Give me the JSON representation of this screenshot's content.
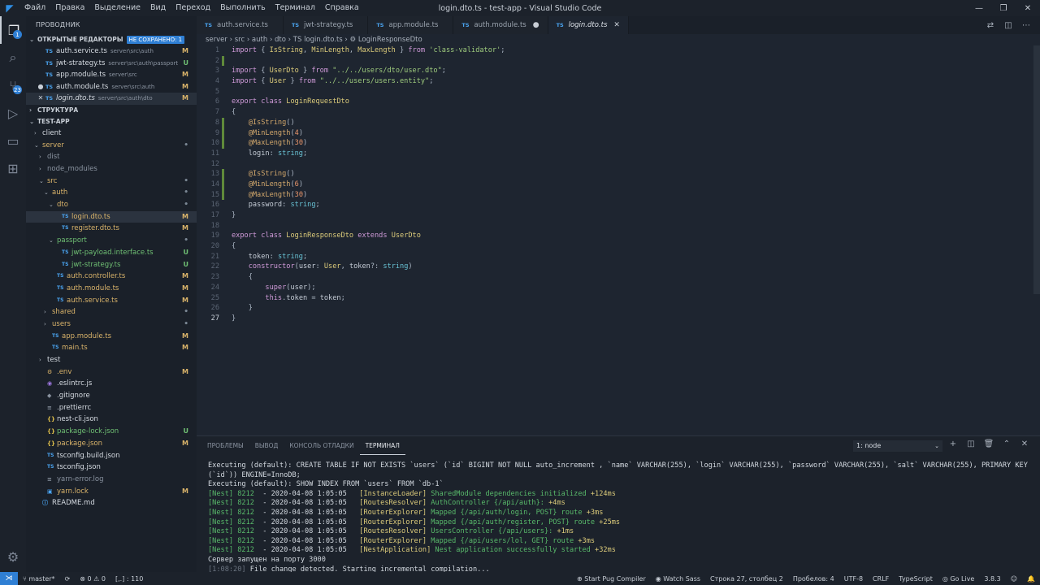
{
  "window": {
    "title": "login.dto.ts - test-app - Visual Studio Code",
    "menu": [
      "Файл",
      "Правка",
      "Выделение",
      "Вид",
      "Переход",
      "Выполнить",
      "Терминал",
      "Справка"
    ]
  },
  "activity": {
    "scm_badge": "23",
    "explorer_badge": "1"
  },
  "sidebar": {
    "title": "ПРОВОДНИК",
    "open_editors_label": "ОТКРЫТЫЕ РЕДАКТОРЫ",
    "unsaved_label": "НЕ СОХРАНЕНО: 1",
    "open_editors": [
      {
        "icon": "TS",
        "name": "auth.service.ts",
        "path": "server\\src\\auth",
        "status": "M",
        "mark": ""
      },
      {
        "icon": "TS",
        "name": "jwt-strategy.ts",
        "path": "server\\src\\auth\\passport",
        "status": "U",
        "mark": ""
      },
      {
        "icon": "TS",
        "name": "app.module.ts",
        "path": "server\\src",
        "status": "M",
        "mark": ""
      },
      {
        "icon": "TS",
        "name": "auth.module.ts",
        "path": "server\\src\\auth",
        "status": "M",
        "mark": "●"
      },
      {
        "icon": "TS",
        "name": "login.dto.ts",
        "path": "server\\src\\auth\\dto",
        "status": "M",
        "mark": "✕"
      }
    ],
    "outline_label": "СТРУКТУРА",
    "project_label": "TEST-APP",
    "tree": [
      {
        "depth": 0,
        "twist": "›",
        "icon": "",
        "name": "client",
        "status": "",
        "cls": ""
      },
      {
        "depth": 0,
        "twist": "⌄",
        "icon": "",
        "name": "server",
        "status": "•",
        "cls": "c-M"
      },
      {
        "depth": 1,
        "twist": "›",
        "icon": "",
        "name": "dist",
        "status": "",
        "cls": "c-dim"
      },
      {
        "depth": 1,
        "twist": "›",
        "icon": "",
        "name": "node_modules",
        "status": "",
        "cls": "c-dim"
      },
      {
        "depth": 1,
        "twist": "⌄",
        "icon": "",
        "name": "src",
        "status": "•",
        "cls": "c-M"
      },
      {
        "depth": 2,
        "twist": "⌄",
        "icon": "",
        "name": "auth",
        "status": "•",
        "cls": "c-M"
      },
      {
        "depth": 3,
        "twist": "⌄",
        "icon": "",
        "name": "dto",
        "status": "•",
        "cls": "c-M"
      },
      {
        "depth": 4,
        "twist": "",
        "icon": "TS",
        "name": "login.dto.ts",
        "status": "M",
        "cls": "c-M",
        "sel": true
      },
      {
        "depth": 4,
        "twist": "",
        "icon": "TS",
        "name": "register.dto.ts",
        "status": "M",
        "cls": "c-M"
      },
      {
        "depth": 3,
        "twist": "⌄",
        "icon": "",
        "name": "passport",
        "status": "•",
        "cls": "c-U"
      },
      {
        "depth": 4,
        "twist": "",
        "icon": "TS",
        "name": "jwt-payload.interface.ts",
        "status": "U",
        "cls": "c-U"
      },
      {
        "depth": 4,
        "twist": "",
        "icon": "TS",
        "name": "jwt-strategy.ts",
        "status": "U",
        "cls": "c-U"
      },
      {
        "depth": 3,
        "twist": "",
        "icon": "TS",
        "name": "auth.controller.ts",
        "status": "M",
        "cls": "c-M"
      },
      {
        "depth": 3,
        "twist": "",
        "icon": "TS",
        "name": "auth.module.ts",
        "status": "M",
        "cls": "c-M"
      },
      {
        "depth": 3,
        "twist": "",
        "icon": "TS",
        "name": "auth.service.ts",
        "status": "M",
        "cls": "c-M"
      },
      {
        "depth": 2,
        "twist": "›",
        "icon": "",
        "name": "shared",
        "status": "•",
        "cls": "c-M"
      },
      {
        "depth": 2,
        "twist": "›",
        "icon": "",
        "name": "users",
        "status": "•",
        "cls": "c-M"
      },
      {
        "depth": 2,
        "twist": "",
        "icon": "TS",
        "name": "app.module.ts",
        "status": "M",
        "cls": "c-M"
      },
      {
        "depth": 2,
        "twist": "",
        "icon": "TS",
        "name": "main.ts",
        "status": "M",
        "cls": "c-M"
      },
      {
        "depth": 1,
        "twist": "›",
        "icon": "",
        "name": "test",
        "status": "",
        "cls": ""
      },
      {
        "depth": 1,
        "twist": "",
        "icon": "⚙",
        "name": ".env",
        "status": "M",
        "cls": "c-M"
      },
      {
        "depth": 1,
        "twist": "",
        "icon": "◉",
        "name": ".eslintrc.js",
        "status": "",
        "cls": ""
      },
      {
        "depth": 1,
        "twist": "",
        "icon": "◆",
        "name": ".gitignore",
        "status": "",
        "cls": ""
      },
      {
        "depth": 1,
        "twist": "",
        "icon": "≡",
        "name": ".prettierrc",
        "status": "",
        "cls": ""
      },
      {
        "depth": 1,
        "twist": "",
        "icon": "{}",
        "name": "nest-cli.json",
        "status": "",
        "cls": ""
      },
      {
        "depth": 1,
        "twist": "",
        "icon": "{}",
        "name": "package-lock.json",
        "status": "U",
        "cls": "c-U"
      },
      {
        "depth": 1,
        "twist": "",
        "icon": "{}",
        "name": "package.json",
        "status": "M",
        "cls": "c-M"
      },
      {
        "depth": 1,
        "twist": "",
        "icon": "TS",
        "name": "tsconfig.build.json",
        "status": "",
        "cls": ""
      },
      {
        "depth": 1,
        "twist": "",
        "icon": "TS",
        "name": "tsconfig.json",
        "status": "",
        "cls": ""
      },
      {
        "depth": 1,
        "twist": "",
        "icon": "≡",
        "name": "yarn-error.log",
        "status": "",
        "cls": "c-dim"
      },
      {
        "depth": 1,
        "twist": "",
        "icon": "▣",
        "name": "yarn.lock",
        "status": "M",
        "cls": "c-M"
      },
      {
        "depth": 0,
        "twist": "",
        "icon": "ⓘ",
        "name": "README.md",
        "status": "",
        "cls": ""
      }
    ]
  },
  "tabs": [
    {
      "name": "auth.service.ts",
      "active": false,
      "mark": ""
    },
    {
      "name": "jwt-strategy.ts",
      "active": false,
      "mark": ""
    },
    {
      "name": "app.module.ts",
      "active": false,
      "mark": ""
    },
    {
      "name": "auth.module.ts",
      "active": false,
      "mark": "●"
    },
    {
      "name": "login.dto.ts",
      "active": true,
      "mark": "✕"
    }
  ],
  "breadcrumb": "server › src › auth › dto › TS login.dto.ts › ⚙ LoginResponseDto",
  "code": [
    [
      [
        "k",
        "import"
      ],
      [
        "p",
        " { "
      ],
      [
        "t",
        "IsString"
      ],
      [
        "p",
        ", "
      ],
      [
        "t",
        "MinLength"
      ],
      [
        "p",
        ", "
      ],
      [
        "t",
        "MaxLength"
      ],
      [
        "p",
        " } "
      ],
      [
        "k",
        "from"
      ],
      [
        "p",
        " "
      ],
      [
        "s",
        "'class-validator'"
      ],
      [
        "p",
        ";"
      ]
    ],
    [],
    [
      [
        "k",
        "import"
      ],
      [
        "p",
        " { "
      ],
      [
        "t",
        "UserDto"
      ],
      [
        "p",
        " } "
      ],
      [
        "k",
        "from"
      ],
      [
        "p",
        " "
      ],
      [
        "s",
        "\"../../users/dto/user.dto\""
      ],
      [
        "p",
        ";"
      ]
    ],
    [
      [
        "k",
        "import"
      ],
      [
        "p",
        " { "
      ],
      [
        "t",
        "User"
      ],
      [
        "p",
        " } "
      ],
      [
        "k",
        "from"
      ],
      [
        "p",
        " "
      ],
      [
        "s",
        "\"../../users/users.entity\""
      ],
      [
        "p",
        ";"
      ]
    ],
    [],
    [
      [
        "k",
        "export"
      ],
      [
        "p",
        " "
      ],
      [
        "k",
        "class"
      ],
      [
        "p",
        " "
      ],
      [
        "t",
        "LoginRequestDto"
      ]
    ],
    [
      [
        "p",
        "{"
      ]
    ],
    [
      [
        "p",
        "    "
      ],
      [
        "d",
        "@IsString"
      ],
      [
        "p",
        "()"
      ]
    ],
    [
      [
        "p",
        "    "
      ],
      [
        "d",
        "@MinLength"
      ],
      [
        "p",
        "("
      ],
      [
        "n",
        "4"
      ],
      [
        "p",
        ")"
      ]
    ],
    [
      [
        "p",
        "    "
      ],
      [
        "d",
        "@MaxLength"
      ],
      [
        "p",
        "("
      ],
      [
        "n",
        "30"
      ],
      [
        "p",
        ")"
      ]
    ],
    [
      [
        "p",
        "    "
      ],
      [
        "i",
        "login"
      ],
      [
        "p",
        ": "
      ],
      [
        "c",
        "string"
      ],
      [
        "p",
        ";"
      ]
    ],
    [],
    [
      [
        "p",
        "    "
      ],
      [
        "d",
        "@IsString"
      ],
      [
        "p",
        "()"
      ]
    ],
    [
      [
        "p",
        "    "
      ],
      [
        "d",
        "@MinLength"
      ],
      [
        "p",
        "("
      ],
      [
        "n",
        "6"
      ],
      [
        "p",
        ")"
      ]
    ],
    [
      [
        "p",
        "    "
      ],
      [
        "d",
        "@MaxLength"
      ],
      [
        "p",
        "("
      ],
      [
        "n",
        "30"
      ],
      [
        "p",
        ")"
      ]
    ],
    [
      [
        "p",
        "    "
      ],
      [
        "i",
        "password"
      ],
      [
        "p",
        ": "
      ],
      [
        "c",
        "string"
      ],
      [
        "p",
        ";"
      ]
    ],
    [
      [
        "p",
        "}"
      ]
    ],
    [],
    [
      [
        "k",
        "export"
      ],
      [
        "p",
        " "
      ],
      [
        "k",
        "class"
      ],
      [
        "p",
        " "
      ],
      [
        "t",
        "LoginResponseDto"
      ],
      [
        "p",
        " "
      ],
      [
        "k",
        "extends"
      ],
      [
        "p",
        " "
      ],
      [
        "t",
        "UserDto"
      ]
    ],
    [
      [
        "p",
        "{"
      ]
    ],
    [
      [
        "p",
        "    "
      ],
      [
        "i",
        "token"
      ],
      [
        "p",
        ": "
      ],
      [
        "c",
        "string"
      ],
      [
        "p",
        ";"
      ]
    ],
    [
      [
        "p",
        "    "
      ],
      [
        "k",
        "constructor"
      ],
      [
        "p",
        "("
      ],
      [
        "i",
        "user"
      ],
      [
        "p",
        ": "
      ],
      [
        "t",
        "User"
      ],
      [
        "p",
        ", "
      ],
      [
        "i",
        "token"
      ],
      [
        "p",
        "?: "
      ],
      [
        "c",
        "string"
      ],
      [
        "p",
        ")"
      ]
    ],
    [
      [
        "p",
        "    {"
      ]
    ],
    [
      [
        "p",
        "        "
      ],
      [
        "k",
        "super"
      ],
      [
        "p",
        "("
      ],
      [
        "i",
        "user"
      ],
      [
        "p",
        ");"
      ]
    ],
    [
      [
        "p",
        "        "
      ],
      [
        "k",
        "this"
      ],
      [
        "p",
        "."
      ],
      [
        "i",
        "token"
      ],
      [
        "p",
        " = "
      ],
      [
        "i",
        "token"
      ],
      [
        "p",
        ";"
      ]
    ],
    [
      [
        "p",
        "    }"
      ]
    ],
    [
      [
        "p",
        "}"
      ]
    ]
  ],
  "modified_lines": [
    2,
    8,
    9,
    10,
    13,
    14,
    15
  ],
  "current_line": 27,
  "panel": {
    "tabs": [
      "ПРОБЛЕМЫ",
      "ВЫВОД",
      "КОНСОЛЬ ОТЛАДКИ",
      "ТЕРМИНАЛ"
    ],
    "active_tab": "ТЕРМИНАЛ",
    "terminal_select": "1: node"
  },
  "terminal": [
    {
      "kind": "plain",
      "text": "Executing (default): CREATE TABLE IF NOT EXISTS `users` (`id` BIGINT NOT NULL auto_increment , `name` VARCHAR(255), `login` VARCHAR(255), `password` VARCHAR(255), `salt` VARCHAR(255), PRIMARY KEY (`id`)) ENGINE=InnoDB;"
    },
    {
      "kind": "plain",
      "text": "Executing (default): SHOW INDEX FROM `users` FROM `db-1`"
    },
    {
      "kind": "nest",
      "pid": "[Nest] 8212",
      "date": "  - 2020-04-08 1:05:05",
      "ctx": "[InstanceLoader]",
      "msg": "SharedModule dependencies initialized",
      "time": "+124ms"
    },
    {
      "kind": "nest",
      "pid": "[Nest] 8212",
      "date": "  - 2020-04-08 1:05:05",
      "ctx": "[RoutesResolver]",
      "msg": "AuthController {/api/auth}:",
      "time": "+4ms"
    },
    {
      "kind": "nest",
      "pid": "[Nest] 8212",
      "date": "  - 2020-04-08 1:05:05",
      "ctx": "[RouterExplorer]",
      "msg": "Mapped {/api/auth/login, POST} route",
      "time": "+3ms"
    },
    {
      "kind": "nest",
      "pid": "[Nest] 8212",
      "date": "  - 2020-04-08 1:05:05",
      "ctx": "[RouterExplorer]",
      "msg": "Mapped {/api/auth/register, POST} route",
      "time": "+25ms"
    },
    {
      "kind": "nest",
      "pid": "[Nest] 8212",
      "date": "  - 2020-04-08 1:05:05",
      "ctx": "[RoutesResolver]",
      "msg": "UsersController {/api/users}:",
      "time": "+1ms"
    },
    {
      "kind": "nest",
      "pid": "[Nest] 8212",
      "date": "  - 2020-04-08 1:05:05",
      "ctx": "[RouterExplorer]",
      "msg": "Mapped {/api/users/lol, GET} route",
      "time": "+3ms"
    },
    {
      "kind": "nest",
      "pid": "[Nest] 8212",
      "date": "  - 2020-04-08 1:05:05",
      "ctx": "[NestApplication]",
      "msg": "Nest application successfully started",
      "time": "+32ms"
    },
    {
      "kind": "plain",
      "text": "Сервер запущен на порту 3000"
    },
    {
      "kind": "watch",
      "time": "[1:08:20]",
      "text": " File change detected. Starting incremental compilation..."
    }
  ],
  "status": {
    "branch": "master*",
    "errors": "0",
    "warnings": "0",
    "extra": "[,.] : 110",
    "right": [
      "⊕ Start Pug Compiler",
      "◉ Watch Sass",
      "Строка 27, столбец 2",
      "Пробелов: 4",
      "UTF-8",
      "CRLF",
      "TypeScript",
      "◎ Go Live",
      "3.8.3",
      "☺",
      "🔔"
    ]
  },
  "colors": {
    "accent": "#2f7fd4",
    "modified": "#d9b36a",
    "untracked": "#6fbf73"
  }
}
